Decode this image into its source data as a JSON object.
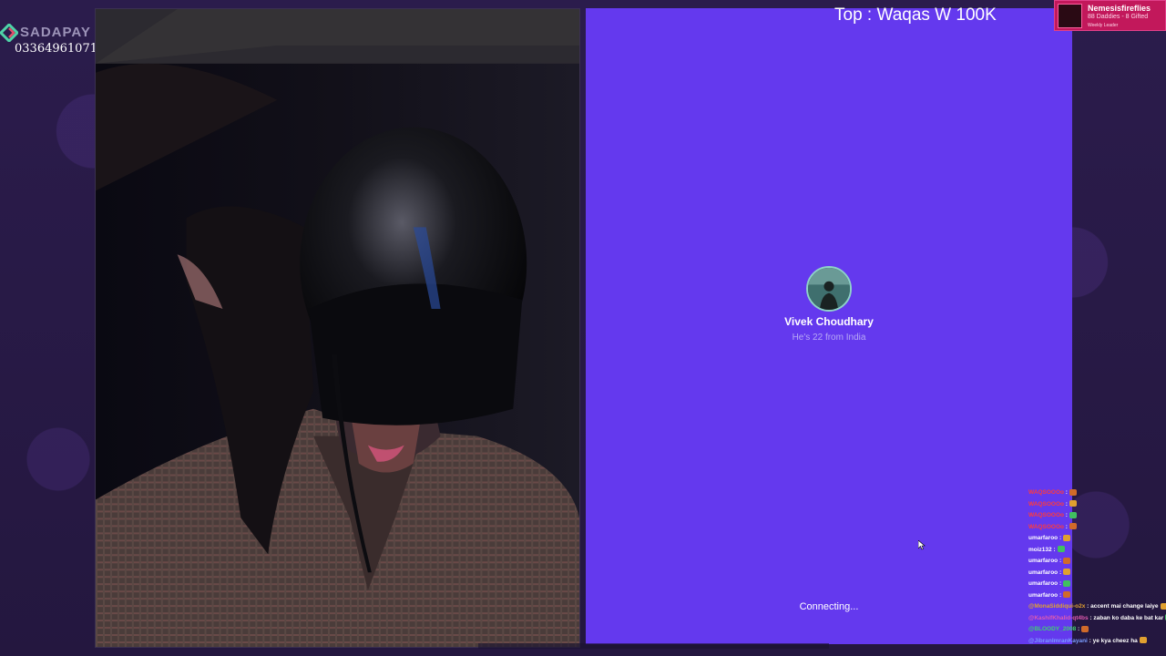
{
  "sadapay": {
    "name": "SADAPAY",
    "number": "03364961071",
    "icon": "sadapay-logo-icon"
  },
  "call": {
    "top_banner": "Top : Waqas W 100K",
    "profile": {
      "name": "Vivek Choudhary",
      "subtitle": "He's 22 from India"
    },
    "status": "Connecting..."
  },
  "leader": {
    "name": "Nemesisfireflies",
    "line1": "88 Daddies - 8 Gifted",
    "line2": "Weekly Leader"
  },
  "chat": {
    "messages": [
      {
        "user": "WAQSOOOo",
        "text": ":",
        "color": "#ff3b3b"
      },
      {
        "user": "WAQSOOOo",
        "text": ":",
        "color": "#ff3b3b"
      },
      {
        "user": "WAQSOOOo",
        "text": ":",
        "color": "#ff3b3b"
      },
      {
        "user": "WAQSOOOo",
        "text": ":",
        "color": "#ff3b3b"
      },
      {
        "user": "umarfaroo",
        "text": ":",
        "color": "#ffffff"
      },
      {
        "user": "moiz132",
        "text": ":",
        "color": "#ffffff"
      },
      {
        "user": "umarfaroo",
        "text": ":",
        "color": "#ffffff"
      },
      {
        "user": "umarfaroo",
        "text": ":",
        "color": "#ffffff"
      },
      {
        "user": "umarfaroo",
        "text": ":",
        "color": "#ffffff"
      },
      {
        "user": "umarfaroo",
        "text": ":",
        "color": "#ffffff"
      },
      {
        "user": "@MonaSiddiqui-o2x",
        "text": ": accent mai change laiye",
        "color": "#e0a030"
      },
      {
        "user": "@KashifKhalid-qt4bs",
        "text": ": zaban ko daba ke bat kar",
        "color": "#e05ab0"
      },
      {
        "user": "@BLOODY_2008",
        "text": ":",
        "color": "#40d070"
      },
      {
        "user": "@JibranImranKayani",
        "text": ": ye kya cheez ha",
        "color": "#7a9cff"
      }
    ]
  },
  "colors": {
    "call_bg": "#6439ee",
    "page_bg": "#2a1b4a",
    "leader_bg": "#c2185b"
  }
}
